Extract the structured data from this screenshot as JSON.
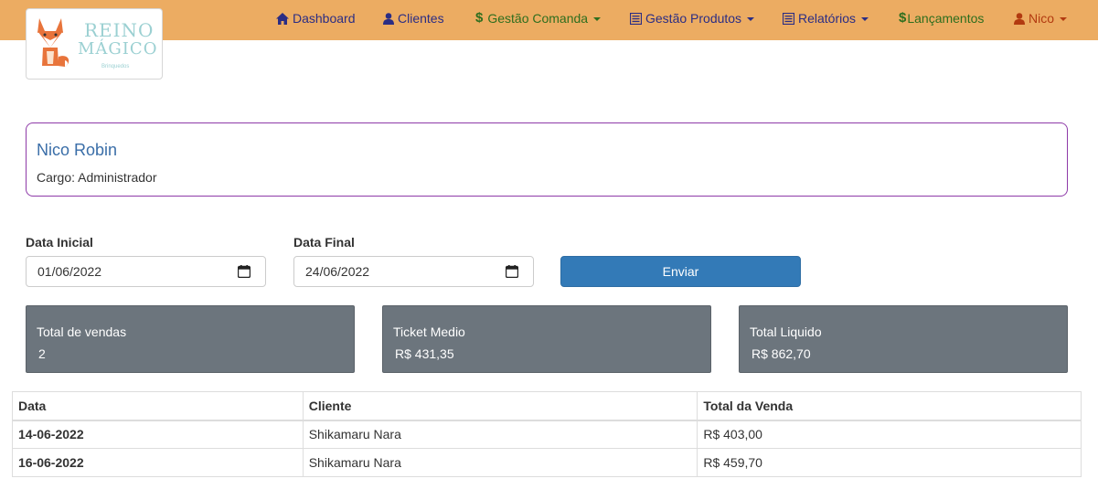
{
  "logo": {
    "line1": "REINO",
    "line2": "MÁGICO",
    "line3": "Brinquedos"
  },
  "nav": {
    "dashboard": "Dashboard",
    "clientes": "Clientes",
    "comanda": "Gestão Comanda",
    "produtos": "Gestão Produtos",
    "relatorios": "Relatórios",
    "lancamentos": "Lançamentos",
    "user": "Nico",
    "dollar": "$",
    "colors": {
      "bar": "#ecac62",
      "primary": "#2b2d84",
      "money": "#2e6e1e",
      "user": "#b23a10"
    }
  },
  "profile": {
    "name": "Nico Robin",
    "role": "Cargo: Administrador"
  },
  "filters": {
    "start_label": "Data Inicial",
    "start_value": "01/06/2022",
    "end_label": "Data Final",
    "end_value": "24/06/2022",
    "submit_label": "Enviar"
  },
  "stats": [
    {
      "title": "Total de vendas",
      "value": "2"
    },
    {
      "title": "Ticket Medio",
      "value": "R$ 431,35"
    },
    {
      "title": "Total Liquido",
      "value": "R$ 862,70"
    }
  ],
  "table": {
    "headers": [
      "Data",
      "Cliente",
      "Total da Venda"
    ],
    "rows": [
      [
        "14-06-2022",
        "Shikamaru Nara",
        "R$ 403,00"
      ],
      [
        "16-06-2022",
        "Shikamaru Nara",
        "R$ 459,70"
      ]
    ]
  }
}
